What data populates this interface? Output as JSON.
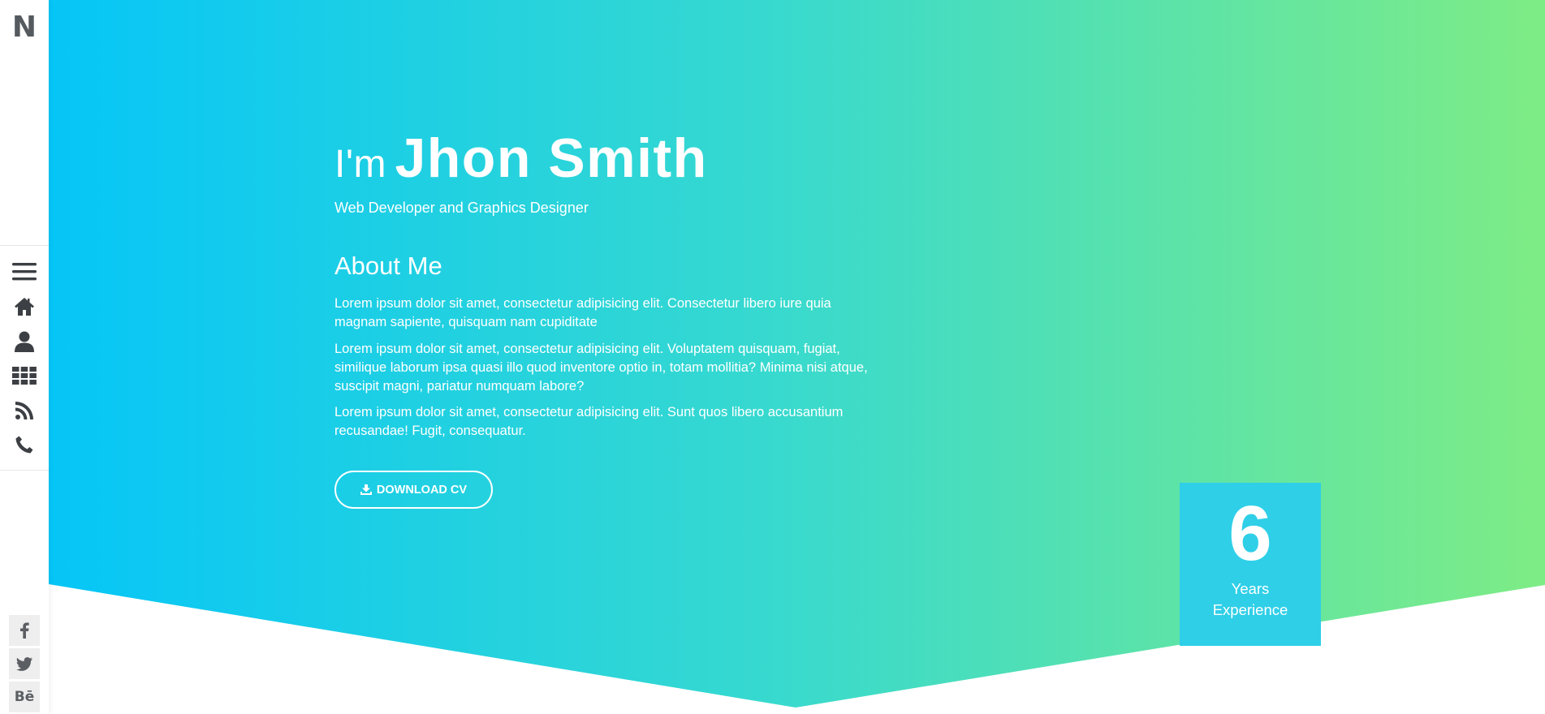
{
  "sidebar": {
    "logo": "N",
    "nav": [
      {
        "icon": "menu-icon"
      },
      {
        "icon": "home-icon"
      },
      {
        "icon": "user-icon"
      },
      {
        "icon": "grid-icon"
      },
      {
        "icon": "rss-icon"
      },
      {
        "icon": "phone-icon"
      }
    ],
    "social": [
      {
        "icon": "facebook-icon"
      },
      {
        "icon": "twitter-icon"
      },
      {
        "icon": "behance-icon",
        "text": "Bē"
      }
    ]
  },
  "hero": {
    "greeting": "I'm",
    "name": "Jhon Smith",
    "subtitle": "Web Developer and Graphics Designer",
    "about_heading": "About Me",
    "paragraphs": [
      "Lorem ipsum dolor sit amet, consectetur adipisicing elit. Consectetur libero iure quia magnam sapiente, quisquam nam cupiditate",
      "Lorem ipsum dolor sit amet, consectetur adipisicing elit. Voluptatem quisquam, fugiat, similique laborum ipsa quasi illo quod inventore optio in, totam mollitia? Minima nisi atque, suscipit magni, pariatur numquam labore?",
      "Lorem ipsum dolor sit amet, consectetur adipisicing elit. Sunt quos libero accusantium recusandae! Fugit, consequatur."
    ],
    "cv_button": "DOWNLOAD CV",
    "cv_icon": "download-icon"
  },
  "experience": {
    "number": "6",
    "line1": "Years",
    "line2": "Experience"
  },
  "colors": {
    "gradient_start": "#06c6f7",
    "gradient_mid": "#37d9cf",
    "gradient_end": "#7eec85",
    "exp_box": "#2fcfe8",
    "icon": "#3c3f43"
  }
}
